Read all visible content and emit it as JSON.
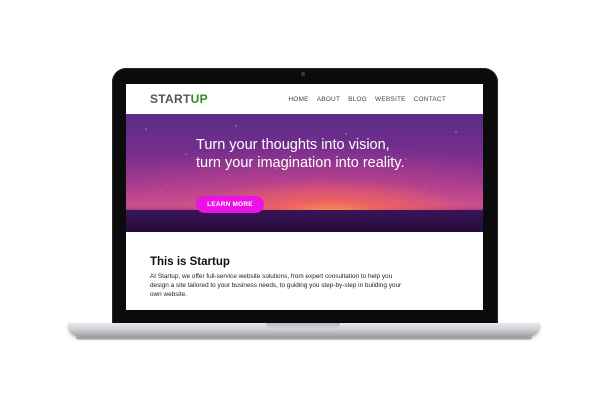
{
  "site": {
    "logo_part1": "START",
    "logo_part2": "UP",
    "nav": [
      "HOME",
      "ABOUT",
      "BLOG",
      "WEBSITE",
      "CONTACT"
    ],
    "hero": {
      "headline": "Turn your thoughts into vision, turn your imagination into reality.",
      "cta_label": "LEARN MORE"
    },
    "section": {
      "title": "This is Startup",
      "body": "At Startup, we offer full-service website solutions, from expert consultation to help you design a site tailored to your business needs, to guiding you step-by-step in building your own website."
    }
  },
  "colors": {
    "logo_accent": "#2e8b21",
    "cta": "#ec11e6",
    "laptop_bezel": "#0b0b0c"
  }
}
